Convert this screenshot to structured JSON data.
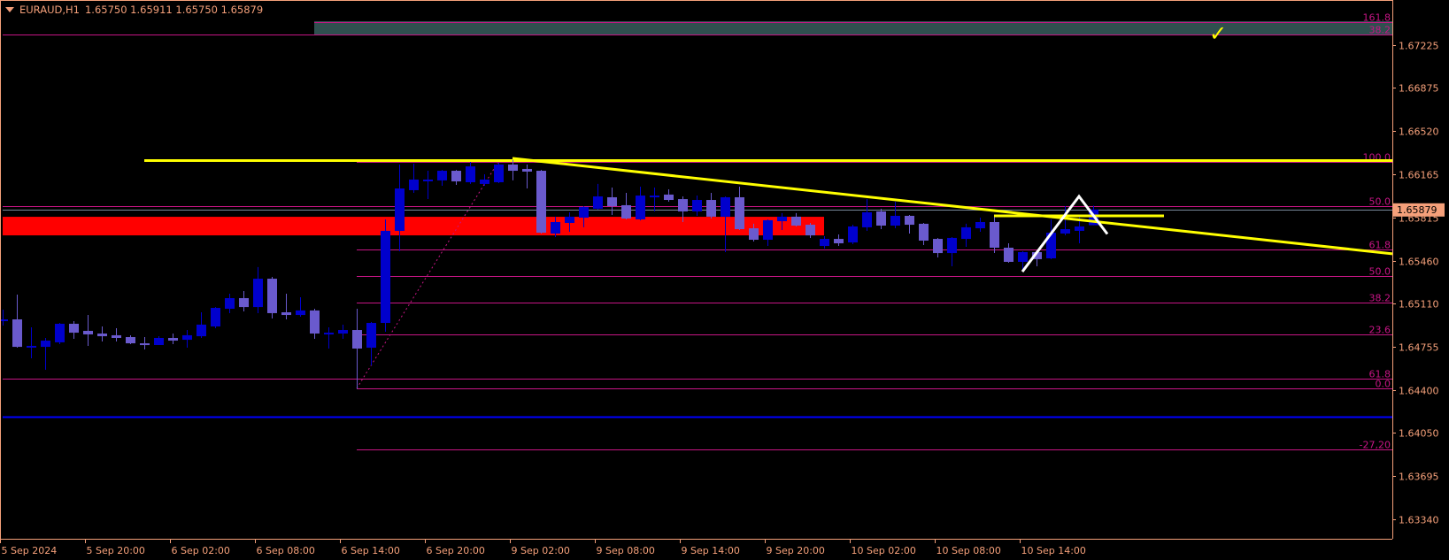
{
  "header": {
    "symbol": "EURAUD,H1",
    "ohlc": "1.65750 1.65911 1.65750 1.65879"
  },
  "colors": {
    "background": "#000000",
    "axis": "#f5a07a",
    "bull": "#0000cd",
    "bear": "#6a5acd",
    "fib": "#c71585",
    "trend": "#ffff00",
    "zone_red": "#ff0000",
    "zone_teal": "#2f4f4f",
    "bid_line": "#778899",
    "support_blue": "#0000ff",
    "zigzag": "#ffffff",
    "price_tag": "#f5a07a"
  },
  "icons": {
    "menu": "triangle-down-icon",
    "mark": "checkmark-icon"
  },
  "chart_data": {
    "type": "candlestick",
    "symbol": "EURAUD",
    "timeframe": "H1",
    "ylim": [
      1.63182,
      1.67595
    ],
    "grid": false,
    "y_ticks": [
      "1.67225",
      "1.66875",
      "1.66520",
      "1.66165",
      "1.65815",
      "1.65460",
      "1.65110",
      "1.64755",
      "1.64400",
      "1.64050",
      "1.63695",
      "1.63340"
    ],
    "x_ticks": [
      {
        "label": "5 Sep 2024",
        "t": "2024-09-05 14:00"
      },
      {
        "label": "5 Sep 20:00",
        "t": "2024-09-05 20:00"
      },
      {
        "label": "6 Sep 02:00",
        "t": "2024-09-06 02:00"
      },
      {
        "label": "6 Sep 08:00",
        "t": "2024-09-06 08:00"
      },
      {
        "label": "6 Sep 14:00",
        "t": "2024-09-06 14:00"
      },
      {
        "label": "6 Sep 20:00",
        "t": "2024-09-06 20:00"
      },
      {
        "label": "9 Sep 02:00",
        "t": "2024-09-09 02:00"
      },
      {
        "label": "9 Sep 08:00",
        "t": "2024-09-09 08:00"
      },
      {
        "label": "9 Sep 14:00",
        "t": "2024-09-09 14:00"
      },
      {
        "label": "9 Sep 20:00",
        "t": "2024-09-09 20:00"
      },
      {
        "label": "10 Sep 02:00",
        "t": "2024-09-10 02:00"
      },
      {
        "label": "10 Sep 08:00",
        "t": "2024-09-10 08:00"
      },
      {
        "label": "10 Sep 14:00",
        "t": "2024-09-10 14:00"
      }
    ],
    "current_price": "1.65879",
    "candles": [
      [
        "2024-09-05 14:00",
        1.64965,
        1.65059,
        1.64928,
        1.64979
      ],
      [
        "2024-09-05 15:00",
        1.64979,
        1.65182,
        1.64747,
        1.64754
      ],
      [
        "2024-09-05 16:00",
        1.64762,
        1.64914,
        1.6466,
        1.64762
      ],
      [
        "2024-09-05 17:00",
        1.64754,
        1.64827,
        1.64566,
        1.64805
      ],
      [
        "2024-09-05 18:00",
        1.64791,
        1.6495,
        1.64776,
        1.64943
      ],
      [
        "2024-09-05 19:00",
        1.64943,
        1.64965,
        1.6482,
        1.6487
      ],
      [
        "2024-09-05 20:00",
        1.64885,
        1.65015,
        1.64762,
        1.64856
      ],
      [
        "2024-09-05 21:00",
        1.64863,
        1.64921,
        1.64798,
        1.64841
      ],
      [
        "2024-09-05 22:00",
        1.64849,
        1.64907,
        1.64798,
        1.64827
      ],
      [
        "2024-09-05 23:00",
        1.64834,
        1.64849,
        1.64776,
        1.64783
      ],
      [
        "2024-09-06 00:00",
        1.64783,
        1.64834,
        1.64733,
        1.64769
      ],
      [
        "2024-09-06 01:00",
        1.64769,
        1.64841,
        1.64769,
        1.64827
      ],
      [
        "2024-09-06 02:00",
        1.64827,
        1.64863,
        1.64776,
        1.64805
      ],
      [
        "2024-09-06 03:00",
        1.64812,
        1.64892,
        1.64747,
        1.64849
      ],
      [
        "2024-09-06 04:00",
        1.64841,
        1.65037,
        1.64827,
        1.64936
      ],
      [
        "2024-09-06 05:00",
        1.64921,
        1.6508,
        1.64907,
        1.65073
      ],
      [
        "2024-09-06 06:00",
        1.65066,
        1.65189,
        1.6503,
        1.65153
      ],
      [
        "2024-09-06 07:00",
        1.65153,
        1.65211,
        1.65044,
        1.6508
      ],
      [
        "2024-09-06 08:00",
        1.6508,
        1.65407,
        1.6503,
        1.65312
      ],
      [
        "2024-09-06 09:00",
        1.65312,
        1.65327,
        1.64986,
        1.6503
      ],
      [
        "2024-09-06 10:00",
        1.65037,
        1.65189,
        1.64979,
        1.65015
      ],
      [
        "2024-09-06 11:00",
        1.65015,
        1.6516,
        1.65001,
        1.65052
      ],
      [
        "2024-09-06 12:00",
        1.65052,
        1.65066,
        1.6482,
        1.64863
      ],
      [
        "2024-09-06 13:00",
        1.6487,
        1.64914,
        1.6474,
        1.6487
      ],
      [
        "2024-09-06 14:00",
        1.64863,
        1.64936,
        1.6482,
        1.64892
      ],
      [
        "2024-09-06 15:00",
        1.64892,
        1.65066,
        1.6441,
        1.6474
      ],
      [
        "2024-09-06 16:00",
        1.64747,
        1.64957,
        1.64602,
        1.6495
      ],
      [
        "2024-09-06 17:00",
        1.6495,
        1.65798,
        1.64878,
        1.65704
      ],
      [
        "2024-09-06 18:00",
        1.65704,
        1.66247,
        1.65537,
        1.66051
      ],
      [
        "2024-09-06 19:00",
        1.66037,
        1.66254,
        1.66015,
        1.66124
      ],
      [
        "2024-09-06 20:00",
        1.66124,
        1.66196,
        1.65964,
        1.66124
      ],
      [
        "2024-09-06 21:00",
        1.66117,
        1.66203,
        1.66073,
        1.66196
      ],
      [
        "2024-09-06 22:00",
        1.66196,
        1.66203,
        1.6608,
        1.66109
      ],
      [
        "2024-09-06 23:00",
        1.66102,
        1.66269,
        1.66088,
        1.66232
      ],
      [
        "2024-09-09 00:00",
        1.66088,
        1.66167,
        1.66073,
        1.66124
      ],
      [
        "2024-09-09 01:00",
        1.66102,
        1.66261,
        1.66095,
        1.66247
      ],
      [
        "2024-09-09 02:00",
        1.66247,
        1.66305,
        1.66117,
        1.66196
      ],
      [
        "2024-09-09 03:00",
        1.66211,
        1.66247,
        1.66051,
        1.66189
      ],
      [
        "2024-09-09 04:00",
        1.66196,
        1.66203,
        1.65682,
        1.65689
      ],
      [
        "2024-09-09 05:00",
        1.65682,
        1.6582,
        1.65653,
        1.65776
      ],
      [
        "2024-09-09 06:00",
        1.65769,
        1.65856,
        1.65696,
        1.6582
      ],
      [
        "2024-09-09 07:00",
        1.65812,
        1.65906,
        1.65733,
        1.65899
      ],
      [
        "2024-09-09 08:00",
        1.65885,
        1.66088,
        1.65877,
        1.65986
      ],
      [
        "2024-09-09 09:00",
        1.65979,
        1.66059,
        1.65834,
        1.65906
      ],
      [
        "2024-09-09 10:00",
        1.65914,
        1.66015,
        1.65798,
        1.65805
      ],
      [
        "2024-09-09 11:00",
        1.65798,
        1.66066,
        1.6579,
        1.65993
      ],
      [
        "2024-09-09 12:00",
        1.65979,
        1.66059,
        1.65863,
        1.65993
      ],
      [
        "2024-09-09 13:00",
        1.66001,
        1.66044,
        1.65943,
        1.65957
      ],
      [
        "2024-09-09 14:00",
        1.65964,
        1.65986,
        1.65776,
        1.65863
      ],
      [
        "2024-09-09 15:00",
        1.65863,
        1.65993,
        1.65827,
        1.65957
      ],
      [
        "2024-09-09 16:00",
        1.65957,
        1.66015,
        1.65805,
        1.6582
      ],
      [
        "2024-09-09 17:00",
        1.6582,
        1.65986,
        1.6553,
        1.65979
      ],
      [
        "2024-09-09 18:00",
        1.65979,
        1.66066,
        1.65711,
        1.65718
      ],
      [
        "2024-09-09 19:00",
        1.65725,
        1.65762,
        1.65617,
        1.65631
      ],
      [
        "2024-09-09 20:00",
        1.65631,
        1.65798,
        1.6558,
        1.65791
      ],
      [
        "2024-09-09 21:00",
        1.65783,
        1.65849,
        1.65711,
        1.6582
      ],
      [
        "2024-09-09 22:00",
        1.6582,
        1.65849,
        1.6574,
        1.65747
      ],
      [
        "2024-09-09 23:00",
        1.65754,
        1.65769,
        1.65646,
        1.65667
      ],
      [
        "2024-09-10 00:00",
        1.6558,
        1.6566,
        1.65559,
        1.65638
      ],
      [
        "2024-09-10 01:00",
        1.65638,
        1.65675,
        1.6558,
        1.65602
      ],
      [
        "2024-09-10 02:00",
        1.65609,
        1.65754,
        1.65595,
        1.6574
      ],
      [
        "2024-09-10 03:00",
        1.65733,
        1.65964,
        1.65704,
        1.65856
      ],
      [
        "2024-09-10 04:00",
        1.65863,
        1.65885,
        1.65718,
        1.65747
      ],
      [
        "2024-09-10 05:00",
        1.65747,
        1.65943,
        1.65725,
        1.65827
      ],
      [
        "2024-09-10 06:00",
        1.65827,
        1.65834,
        1.65682,
        1.65754
      ],
      [
        "2024-09-10 07:00",
        1.65762,
        1.65769,
        1.65588,
        1.65624
      ],
      [
        "2024-09-10 08:00",
        1.65638,
        1.65646,
        1.65486,
        1.65522
      ],
      [
        "2024-09-10 09:00",
        1.65522,
        1.65653,
        1.65414,
        1.65646
      ],
      [
        "2024-09-10 10:00",
        1.65638,
        1.65762,
        1.65573,
        1.65733
      ],
      [
        "2024-09-10 11:00",
        1.65725,
        1.65812,
        1.65696,
        1.65776
      ],
      [
        "2024-09-10 12:00",
        1.65776,
        1.65827,
        1.65522,
        1.65566
      ],
      [
        "2024-09-10 13:00",
        1.65566,
        1.65602,
        1.65443,
        1.6545
      ],
      [
        "2024-09-10 14:00",
        1.6545,
        1.65537,
        1.6537,
        1.6553
      ],
      [
        "2024-09-10 15:00",
        1.6553,
        1.65537,
        1.65414,
        1.65472
      ],
      [
        "2024-09-10 16:00",
        1.65479,
        1.65798,
        1.65472,
        1.65689
      ],
      [
        "2024-09-10 17:00",
        1.65682,
        1.65906,
        1.65667,
        1.65718
      ],
      [
        "2024-09-10 18:00",
        1.65704,
        1.65827,
        1.65602,
        1.6574
      ],
      [
        "2024-09-10 19:00",
        1.6575,
        1.65911,
        1.6575,
        1.65879
      ]
    ],
    "fib_levels": [
      {
        "label": "161.8",
        "price": 1.67413,
        "from": "2024-09-06 12:00"
      },
      {
        "label": "100.0",
        "price": 1.66269,
        "from": "2024-09-06 15:00"
      },
      {
        "label": "61.8",
        "price": 1.65552,
        "from": "2024-09-06 15:00"
      },
      {
        "label": "50.0",
        "price": 1.65334,
        "from": "2024-09-06 15:00"
      },
      {
        "label": "38.2",
        "price": 1.65117,
        "from": "2024-09-06 15:00"
      },
      {
        "label": "23.6",
        "price": 1.64856,
        "from": "2024-09-06 15:00"
      },
      {
        "label": "0.0",
        "price": 1.64414,
        "from": "2024-09-06 15:00"
      },
      {
        "label": "-27,20",
        "price": 1.63914,
        "from": "2024-09-06 15:00"
      },
      {
        "label": "38.2",
        "price": 1.67312,
        "from": "2024-09-05 14:00"
      },
      {
        "label": "50.0",
        "price": 1.65907,
        "from": "2024-09-05 14:00"
      },
      {
        "label": "61.8",
        "price": 1.64494,
        "from": "2024-09-05 14:00"
      }
    ],
    "fib_diagonal": {
      "from": [
        "2024-09-06 15:00",
        1.64414
      ],
      "to": [
        "2024-09-09 01:00",
        1.66269
      ]
    },
    "zones": [
      {
        "kind": "teal",
        "from": "2024-09-06 12:00",
        "top": 1.67421,
        "bottom": 1.67312
      },
      {
        "kind": "red",
        "from": "2024-09-05 14:00",
        "to": "2024-09-10 00:00",
        "top": 1.65819,
        "bottom": 1.65667
      }
    ],
    "hlines": [
      {
        "kind": "yellow-resistance",
        "price": 1.66283,
        "from": "2024-09-06 00:00"
      },
      {
        "kind": "blue-support",
        "price": 1.64182,
        "from": "2024-09-05 14:00"
      },
      {
        "kind": "bid",
        "price": 1.65879,
        "from": "2024-09-05 14:00"
      }
    ],
    "trendline": {
      "from": [
        "2024-09-09 02:00",
        1.66298
      ],
      "to": [
        "2024-09-10 12:00",
        1.6587
      ],
      "extend_right": true
    },
    "short_line": {
      "from": [
        "2024-09-10 12:00",
        1.65827
      ],
      "to": [
        "2024-09-11 00:00",
        1.65827
      ]
    },
    "zigzag": [
      [
        "2024-09-10 14:00",
        1.6537
      ],
      [
        "2024-09-10 18:00",
        1.65986
      ],
      [
        "2024-09-10 20:00",
        1.65678
      ]
    ]
  }
}
